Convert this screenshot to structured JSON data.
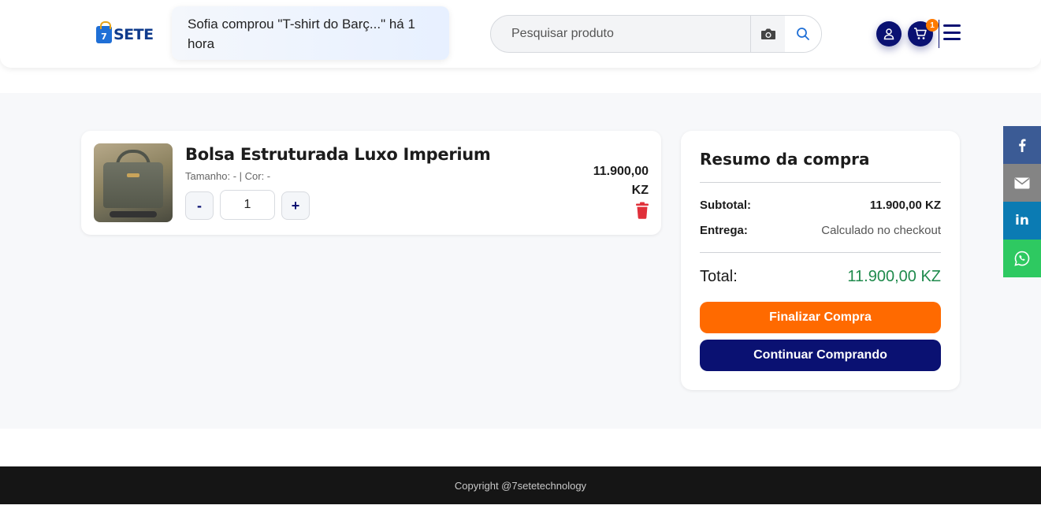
{
  "header": {
    "logo_number": "7",
    "logo_text": "SETE",
    "notification": "Sofia comprou \"T-shirt do Barç...\" há 1 hora",
    "search_placeholder": "Pesquisar produto",
    "cart_count": "1"
  },
  "cart": {
    "items": [
      {
        "title": "Bolsa Estruturada Luxo Imperium",
        "meta": "Tamanho: - | Cor: -",
        "quantity": "1",
        "minus_label": "-",
        "plus_label": "+",
        "price": "11.900,00 KZ"
      }
    ]
  },
  "summary": {
    "title": "Resumo da compra",
    "subtotal_label": "Subtotal:",
    "subtotal_value": "11.900,00 KZ",
    "delivery_label": "Entrega:",
    "delivery_value": "Calculado no checkout",
    "total_label": "Total:",
    "total_value": "11.900,00 KZ",
    "checkout_label": "Finalizar Compra",
    "continue_label": "Continuar Comprando"
  },
  "share": {
    "icons": [
      "facebook-icon",
      "email-icon",
      "linkedin-icon",
      "whatsapp-icon"
    ],
    "linkedin_text": "in"
  },
  "colors": {
    "brand_navy": "#0a1172",
    "checkout_orange": "#ff6a00",
    "total_green": "#1f8a4c",
    "delete_red": "#e0303a"
  },
  "footer": {
    "copyright": "Copyright @7setetechnology"
  }
}
